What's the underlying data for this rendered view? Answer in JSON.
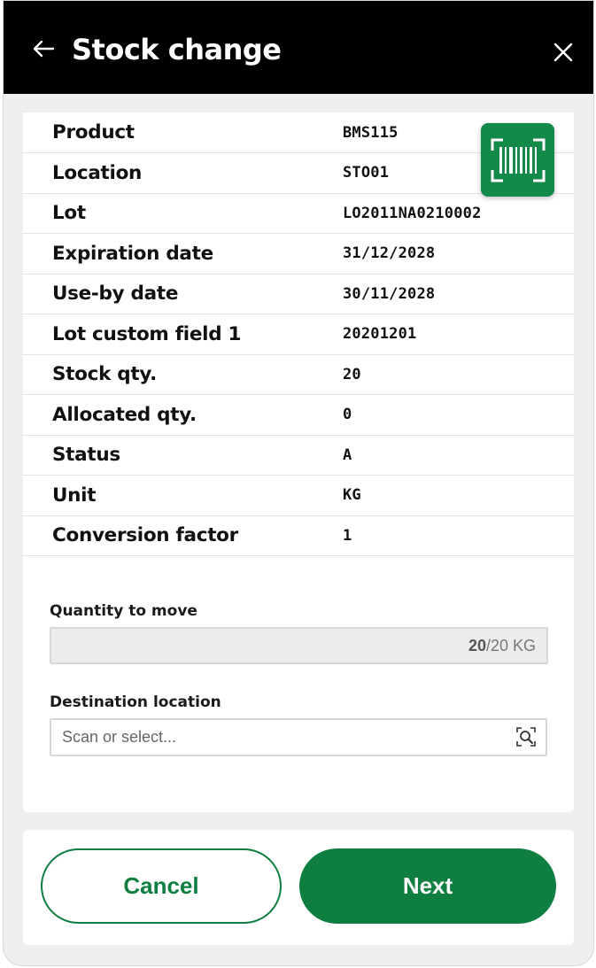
{
  "header": {
    "title": "Stock change",
    "back_icon": "arrow-left-icon",
    "close_icon": "close-icon",
    "background": "#000000"
  },
  "details": [
    {
      "label": "Product",
      "value": "BMS115"
    },
    {
      "label": "Location",
      "value": "STO01"
    },
    {
      "label": "Lot",
      "value": "LO2011NA0210002"
    },
    {
      "label": "Expiration date",
      "value": "31/12/2028"
    },
    {
      "label": "Use-by date",
      "value": "30/11/2028"
    },
    {
      "label": "Lot custom field 1",
      "value": "20201201"
    },
    {
      "label": "Stock qty.",
      "value": "20"
    },
    {
      "label": "Allocated qty.",
      "value": "0"
    },
    {
      "label": "Status",
      "value": "A"
    },
    {
      "label": "Unit",
      "value": "KG"
    },
    {
      "label": "Conversion factor",
      "value": "1"
    }
  ],
  "scan_button": {
    "icon": "barcode-scan-icon",
    "color": "#148a4a"
  },
  "quantity": {
    "label": "Quantity to move",
    "value": "20",
    "suffix": "/20 KG"
  },
  "destination": {
    "label": "Destination location",
    "placeholder": "Scan or select...",
    "icon": "search-lookup-icon"
  },
  "footer": {
    "cancel_label": "Cancel",
    "next_label": "Next",
    "accent": "#0f7f41"
  }
}
